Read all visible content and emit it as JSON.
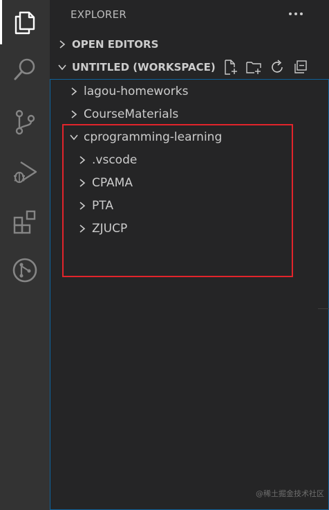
{
  "activity_bar": {
    "items": [
      {
        "name": "explorer"
      },
      {
        "name": "search"
      },
      {
        "name": "source-control"
      },
      {
        "name": "run-debug"
      },
      {
        "name": "extensions"
      },
      {
        "name": "git-graph"
      }
    ]
  },
  "sidebar": {
    "title": "EXPLORER",
    "more_icon": "ellipsis-icon",
    "open_editors": {
      "label": "OPEN EDITORS",
      "expanded": false
    },
    "workspace": {
      "label": "UNTITLED (WORKSPACE)",
      "expanded": true,
      "actions": [
        "new-file-icon",
        "new-folder-icon",
        "refresh-icon",
        "collapse-all-icon"
      ]
    },
    "tree": [
      {
        "label": "lagou-homeworks",
        "depth": 0,
        "expanded": false
      },
      {
        "label": "CourseMaterials",
        "depth": 0,
        "expanded": false
      },
      {
        "label": "cprogramming-learning",
        "depth": 0,
        "expanded": true
      },
      {
        "label": ".vscode",
        "depth": 1,
        "expanded": false
      },
      {
        "label": "CPAMA",
        "depth": 1,
        "expanded": false
      },
      {
        "label": "PTA",
        "depth": 1,
        "expanded": false
      },
      {
        "label": "ZJUCP",
        "depth": 1,
        "expanded": false
      }
    ]
  },
  "annotation": {
    "color": "#e2242b"
  },
  "watermark": "@稀土掘金技术社区",
  "colors": {
    "activity_bar_bg": "#333333",
    "sidebar_bg": "#252526",
    "focus_border": "#0e639c",
    "text": "#cccccc"
  }
}
